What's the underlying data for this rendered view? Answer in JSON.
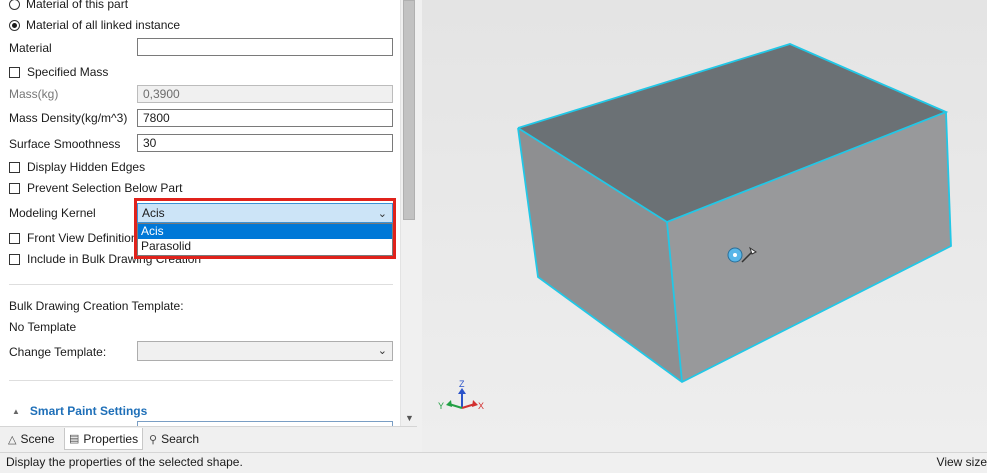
{
  "properties": {
    "radio_this_part": "Material of this part",
    "radio_all_linked": "Material of all linked instance",
    "material_label": "Material",
    "material_value": "",
    "specified_mass_label": "Specified Mass",
    "mass_label": "Mass(kg)",
    "mass_value": "0,3900",
    "density_label": "Mass Density(kg/m^3)",
    "density_value": "7800",
    "smoothness_label": "Surface Smoothness",
    "smoothness_value": "30",
    "hidden_edges_label": "Display Hidden Edges",
    "prevent_selection_label": "Prevent Selection Below Part",
    "kernel_label": "Modeling Kernel",
    "kernel_value": "Acis",
    "kernel_options": [
      "Acis",
      "Parasolid"
    ],
    "front_view_label": "Front View Definition",
    "bulk_include_label": "Include in Bulk Drawing Creation",
    "bulk_template_label": "Bulk Drawing Creation Template:",
    "no_template": "No Template",
    "change_template_label": "Change Template:",
    "change_template_value": "",
    "smart_paint_label": "Smart Paint Settings"
  },
  "tabs": [
    {
      "label": "Scene",
      "icon": "scene-icon"
    },
    {
      "label": "Properties",
      "icon": "properties-icon"
    },
    {
      "label": "Search",
      "icon": "search-icon"
    }
  ],
  "status": {
    "text": "Display the properties of the selected shape.",
    "right": "View size"
  },
  "triad": {
    "z": "Z",
    "y": "Y",
    "x": "X"
  },
  "colors": {
    "edge_highlight": "#22c7e6",
    "face_top": "#6b7175",
    "face_front": "#8e8f91",
    "face_side": "#98999b",
    "dropdown_highlight": "#0078d7",
    "annotation": "#e0221b"
  }
}
